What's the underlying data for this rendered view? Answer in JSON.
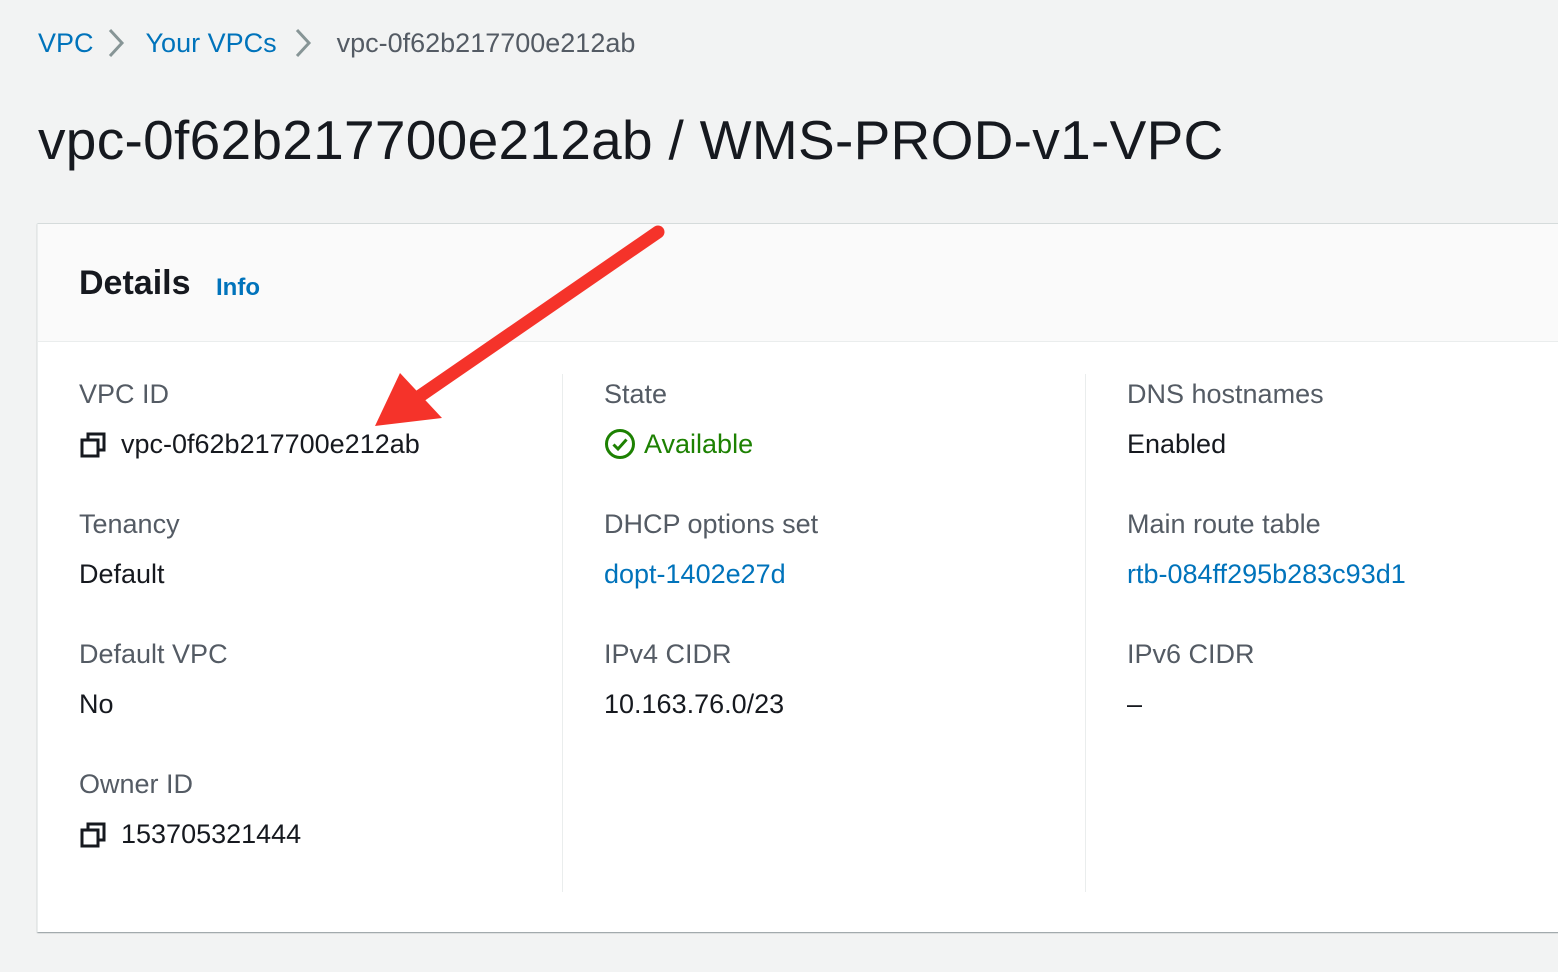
{
  "breadcrumb": {
    "items": [
      "VPC",
      "Your VPCs",
      "vpc-0f62b217700e212ab"
    ]
  },
  "page": {
    "title": "vpc-0f62b217700e212ab / WMS-PROD-v1-VPC"
  },
  "details": {
    "title": "Details",
    "info_label": "Info",
    "vpc_id": {
      "label": "VPC ID",
      "value": "vpc-0f62b217700e212ab"
    },
    "tenancy": {
      "label": "Tenancy",
      "value": "Default"
    },
    "default_vpc": {
      "label": "Default VPC",
      "value": "No"
    },
    "owner_id": {
      "label": "Owner ID",
      "value": "153705321444"
    },
    "state": {
      "label": "State",
      "value": "Available"
    },
    "dhcp_options_set": {
      "label": "DHCP options set",
      "value": "dopt-1402e27d"
    },
    "ipv4_cidr": {
      "label": "IPv4 CIDR",
      "value": "10.163.76.0/23"
    },
    "dns_hostnames": {
      "label": "DNS hostnames",
      "value": "Enabled"
    },
    "main_route_table": {
      "label": "Main route table",
      "value": "rtb-084ff295b283c93d1"
    },
    "ipv6_cidr": {
      "label": "IPv6 CIDR",
      "value": "–"
    }
  },
  "colors": {
    "link": "#0073bb",
    "success": "#1d8102",
    "annotation_arrow": "#f5332a",
    "background": "#f2f3f3"
  },
  "icons": {
    "breadcrumb_separator": "chevron-right-icon",
    "copy": "copy-icon",
    "status": "status-check-icon",
    "annotation": "annotation-arrow"
  }
}
